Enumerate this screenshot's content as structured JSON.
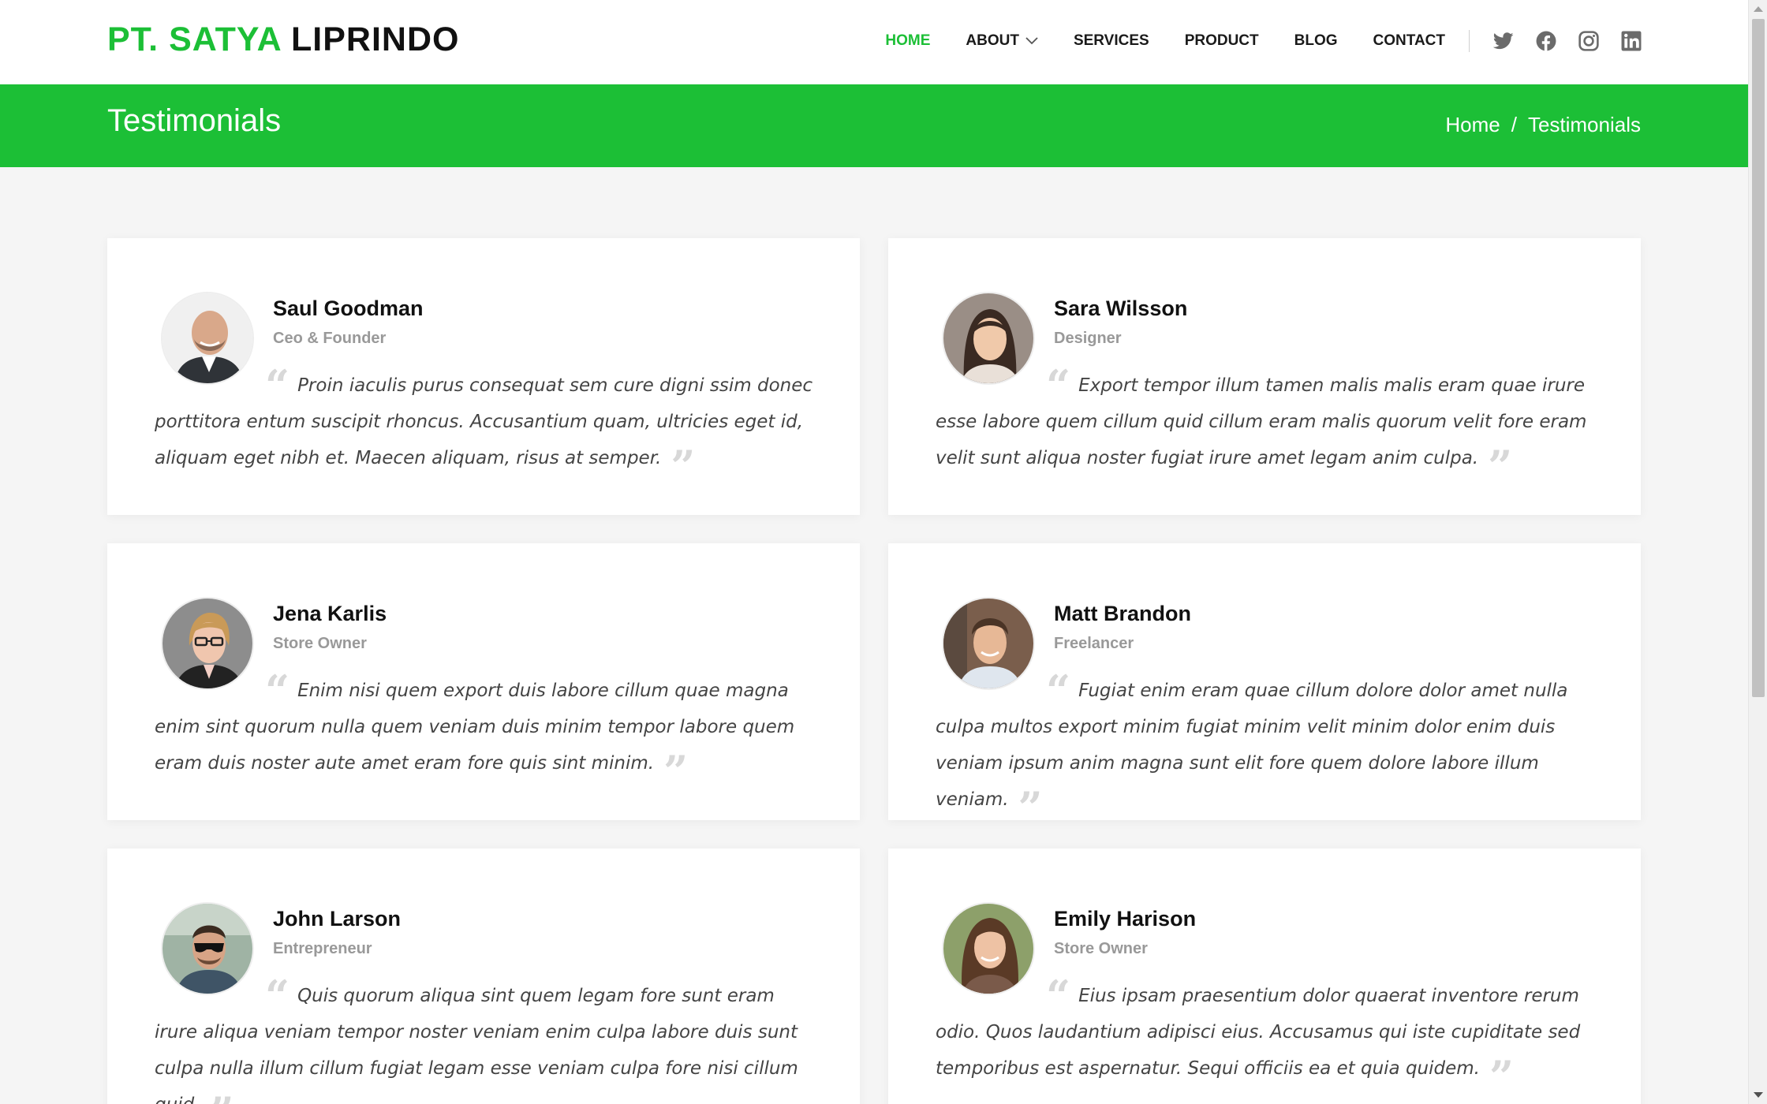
{
  "brand": {
    "accent": "PT. SATYA",
    "rest": "LIPRINDO",
    "accent_color": "#1cbf36"
  },
  "nav": {
    "items": [
      {
        "label": "HOME",
        "active": true
      },
      {
        "label": "ABOUT",
        "dropdown": true
      },
      {
        "label": "SERVICES"
      },
      {
        "label": "PRODUCT"
      },
      {
        "label": "BLOG"
      },
      {
        "label": "CONTACT"
      }
    ],
    "social": [
      "twitter-icon",
      "facebook-icon",
      "instagram-icon",
      "linkedin-icon"
    ]
  },
  "banner": {
    "title": "Testimonials",
    "breadcrumb": {
      "home": "Home",
      "separator": "/",
      "current": "Testimonials"
    }
  },
  "testimonials": [
    {
      "name": "Saul Goodman",
      "role": "Ceo & Founder",
      "text": "Proin iaculis purus consequat sem cure digni ssim donec porttitora entum suscipit rhoncus. Accusantium quam, ultricies eget id, aliquam eget nibh et. Maecen aliquam, risus at semper.",
      "avatar": "man-bald-beard"
    },
    {
      "name": "Sara Wilsson",
      "role": "Designer",
      "text": "Export tempor illum tamen malis malis eram quae irure esse labore quem cillum quid cillum eram malis quorum velit fore eram velit sunt aliqua noster fugiat irure amet legam anim culpa.",
      "avatar": "woman-dark-hair"
    },
    {
      "name": "Jena Karlis",
      "role": "Store Owner",
      "text": "Enim nisi quem export duis labore cillum quae magna enim sint quorum nulla quem veniam duis minim tempor labore quem eram duis noster aute amet eram fore quis sint minim.",
      "avatar": "woman-glasses-blonde"
    },
    {
      "name": "Matt Brandon",
      "role": "Freelancer",
      "text": "Fugiat enim eram quae cillum dolore dolor amet nulla culpa multos export minim fugiat minim velit minim dolor enim duis veniam ipsum anim magna sunt elit fore quem dolore labore illum veniam.",
      "avatar": "man-brown-hair"
    },
    {
      "name": "John Larson",
      "role": "Entrepreneur",
      "text": "Quis quorum aliqua sint quem legam fore sunt eram irure aliqua veniam tempor noster veniam enim culpa labore duis sunt culpa nulla illum cillum fugiat legam esse veniam culpa fore nisi cillum quid.",
      "avatar": "man-sunglasses"
    },
    {
      "name": "Emily Harison",
      "role": "Store Owner",
      "text": "Eius ipsam praesentium dolor quaerat inventore rerum odio. Quos laudantium adipisci eius. Accusamus qui iste cupiditate sed temporibus est aspernatur. Sequi officiis ea et quia quidem.",
      "avatar": "woman-long-brown-hair"
    }
  ]
}
